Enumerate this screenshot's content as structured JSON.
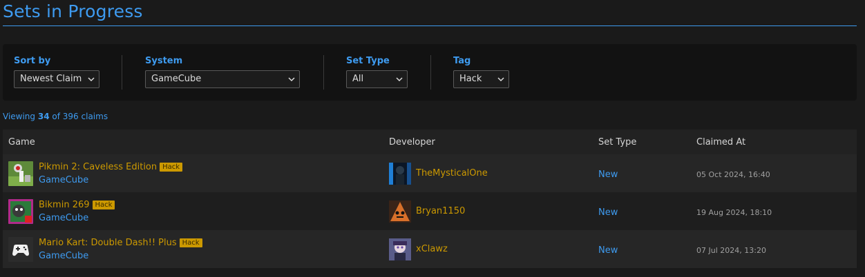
{
  "page": {
    "title": "Sets in Progress"
  },
  "filters": {
    "sort_by": {
      "label": "Sort by",
      "value": "Newest Claim"
    },
    "system": {
      "label": "System",
      "value": "GameCube"
    },
    "set_type": {
      "label": "Set Type",
      "value": "All"
    },
    "tag": {
      "label": "Tag",
      "value": "Hack"
    }
  },
  "summary": {
    "prefix": "Viewing",
    "shown": "34",
    "middle": "of 396 claims"
  },
  "table": {
    "headers": {
      "game": "Game",
      "developer": "Developer",
      "set_type": "Set Type",
      "claimed_at": "Claimed At"
    },
    "rows": [
      {
        "game": "Pikmin 2: Caveless Edition",
        "badge": "Hack",
        "system": "GameCube",
        "developer": "TheMysticalOne",
        "set_type": "New",
        "claimed_at": "05 Oct 2024, 16:40"
      },
      {
        "game": "Bikmin 269",
        "badge": "Hack",
        "system": "GameCube",
        "developer": "Bryan1150",
        "set_type": "New",
        "claimed_at": "19 Aug 2024, 18:10"
      },
      {
        "game": "Mario Kart: Double Dash!! Plus",
        "badge": "Hack",
        "system": "GameCube",
        "developer": "xClawz",
        "set_type": "New",
        "claimed_at": "07 Jul 2024, 13:20"
      }
    ]
  },
  "colors": {
    "accent": "#3e9bf0",
    "gold": "#cc9900",
    "background": "#1a1a1a"
  }
}
